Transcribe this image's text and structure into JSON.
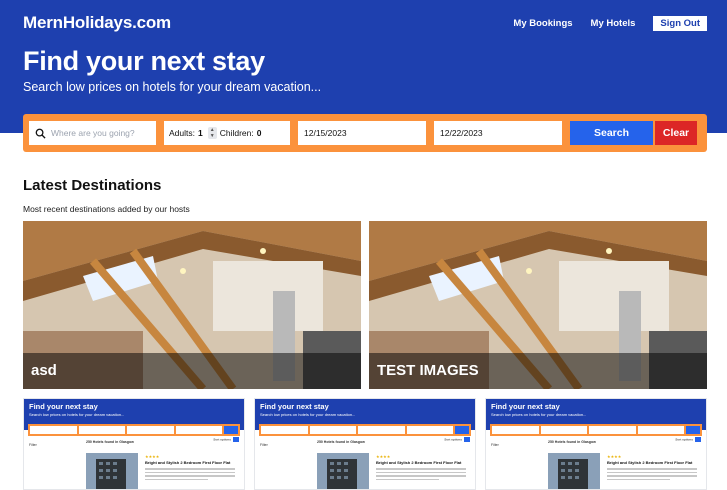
{
  "header": {
    "brand": "MernHolidays.com",
    "nav": {
      "bookings": "My Bookings",
      "hotels": "My Hotels",
      "signout": "Sign Out"
    }
  },
  "hero": {
    "title": "Find your next stay",
    "subtitle": "Search low prices on hotels for your dream vacation..."
  },
  "search": {
    "destination_placeholder": "Where are you going?",
    "adults_label": "Adults:",
    "adults_value": "1",
    "children_label": "Children:",
    "children_value": "0",
    "check_in": "12/15/2023",
    "check_out": "12/22/2023",
    "search_label": "Search",
    "clear_label": "Clear"
  },
  "latest": {
    "title": "Latest Destinations",
    "subtitle": "Most recent destinations added by our hosts",
    "cards": [
      {
        "name": "asd"
      },
      {
        "name": "TEST IMAGES"
      }
    ]
  },
  "thumbnails": {
    "title": "Find your next stay",
    "subtitle": "Search low prices on hotels for your dream vacation...",
    "search_label": "Search",
    "results": "250 Hotels found in Glasgow",
    "filter": "Filter",
    "sort": "Sort options",
    "hotel_title": "Bright and Stylish 2 Bedroom First Floor Flat",
    "stars": "★★★★"
  },
  "colors": {
    "brand_blue": "#1e40af",
    "accent_orange": "#fb923c",
    "search_blue": "#2563eb",
    "clear_red": "#dc2626"
  },
  "icons": {
    "search": "magnifier-icon",
    "stepper": "stepper-arrows-icon"
  }
}
